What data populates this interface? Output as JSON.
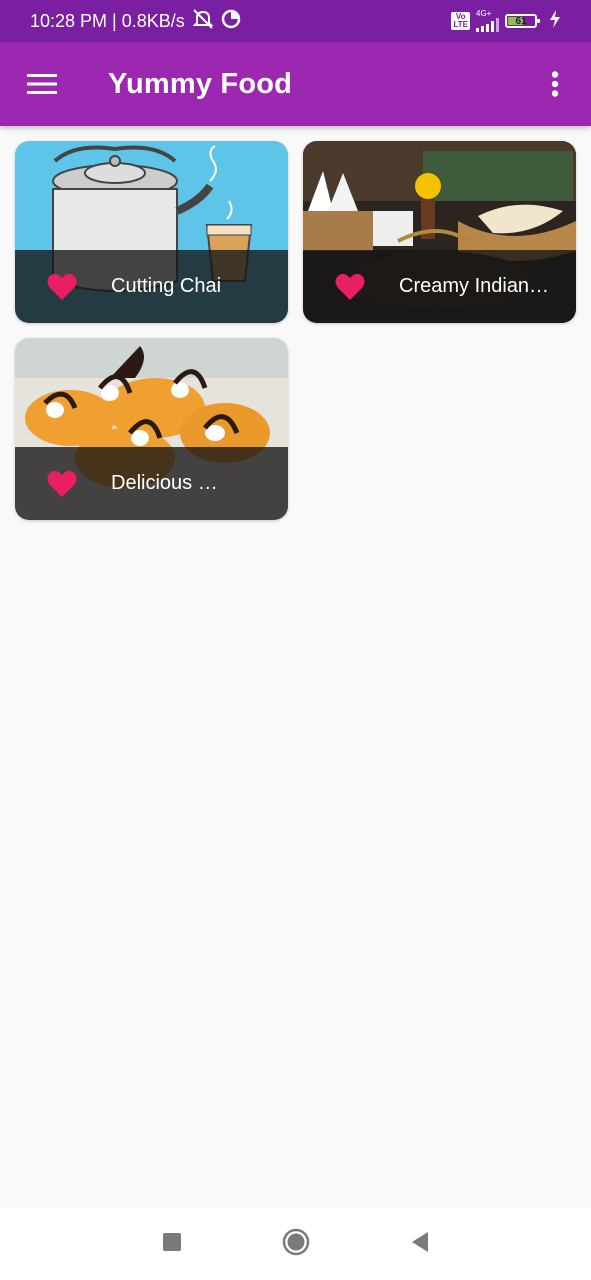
{
  "status_bar": {
    "time_speed": "10:28 PM | 0.8KB/s",
    "volte": "Vo\nLTE",
    "network": "4G+",
    "battery": "61",
    "battery_level": 0.61
  },
  "app_bar": {
    "title": "Yummy Food",
    "menu_icon": "hamburger-menu-icon",
    "more_icon": "more-vert-icon"
  },
  "recipes": [
    {
      "title": "Cutting Chai",
      "favorite": true
    },
    {
      "title": "Creamy Indian…",
      "favorite": true
    },
    {
      "title": "Delicious …",
      "favorite": true
    }
  ],
  "colors": {
    "status_bar": "#7b1fa2",
    "app_bar": "#9c27b0",
    "heart": "#e91e63",
    "background": "#f9f9f9"
  },
  "nav_bar": {
    "recents_icon": "square-recents-icon",
    "home_icon": "circle-home-icon",
    "back_icon": "triangle-back-icon"
  }
}
